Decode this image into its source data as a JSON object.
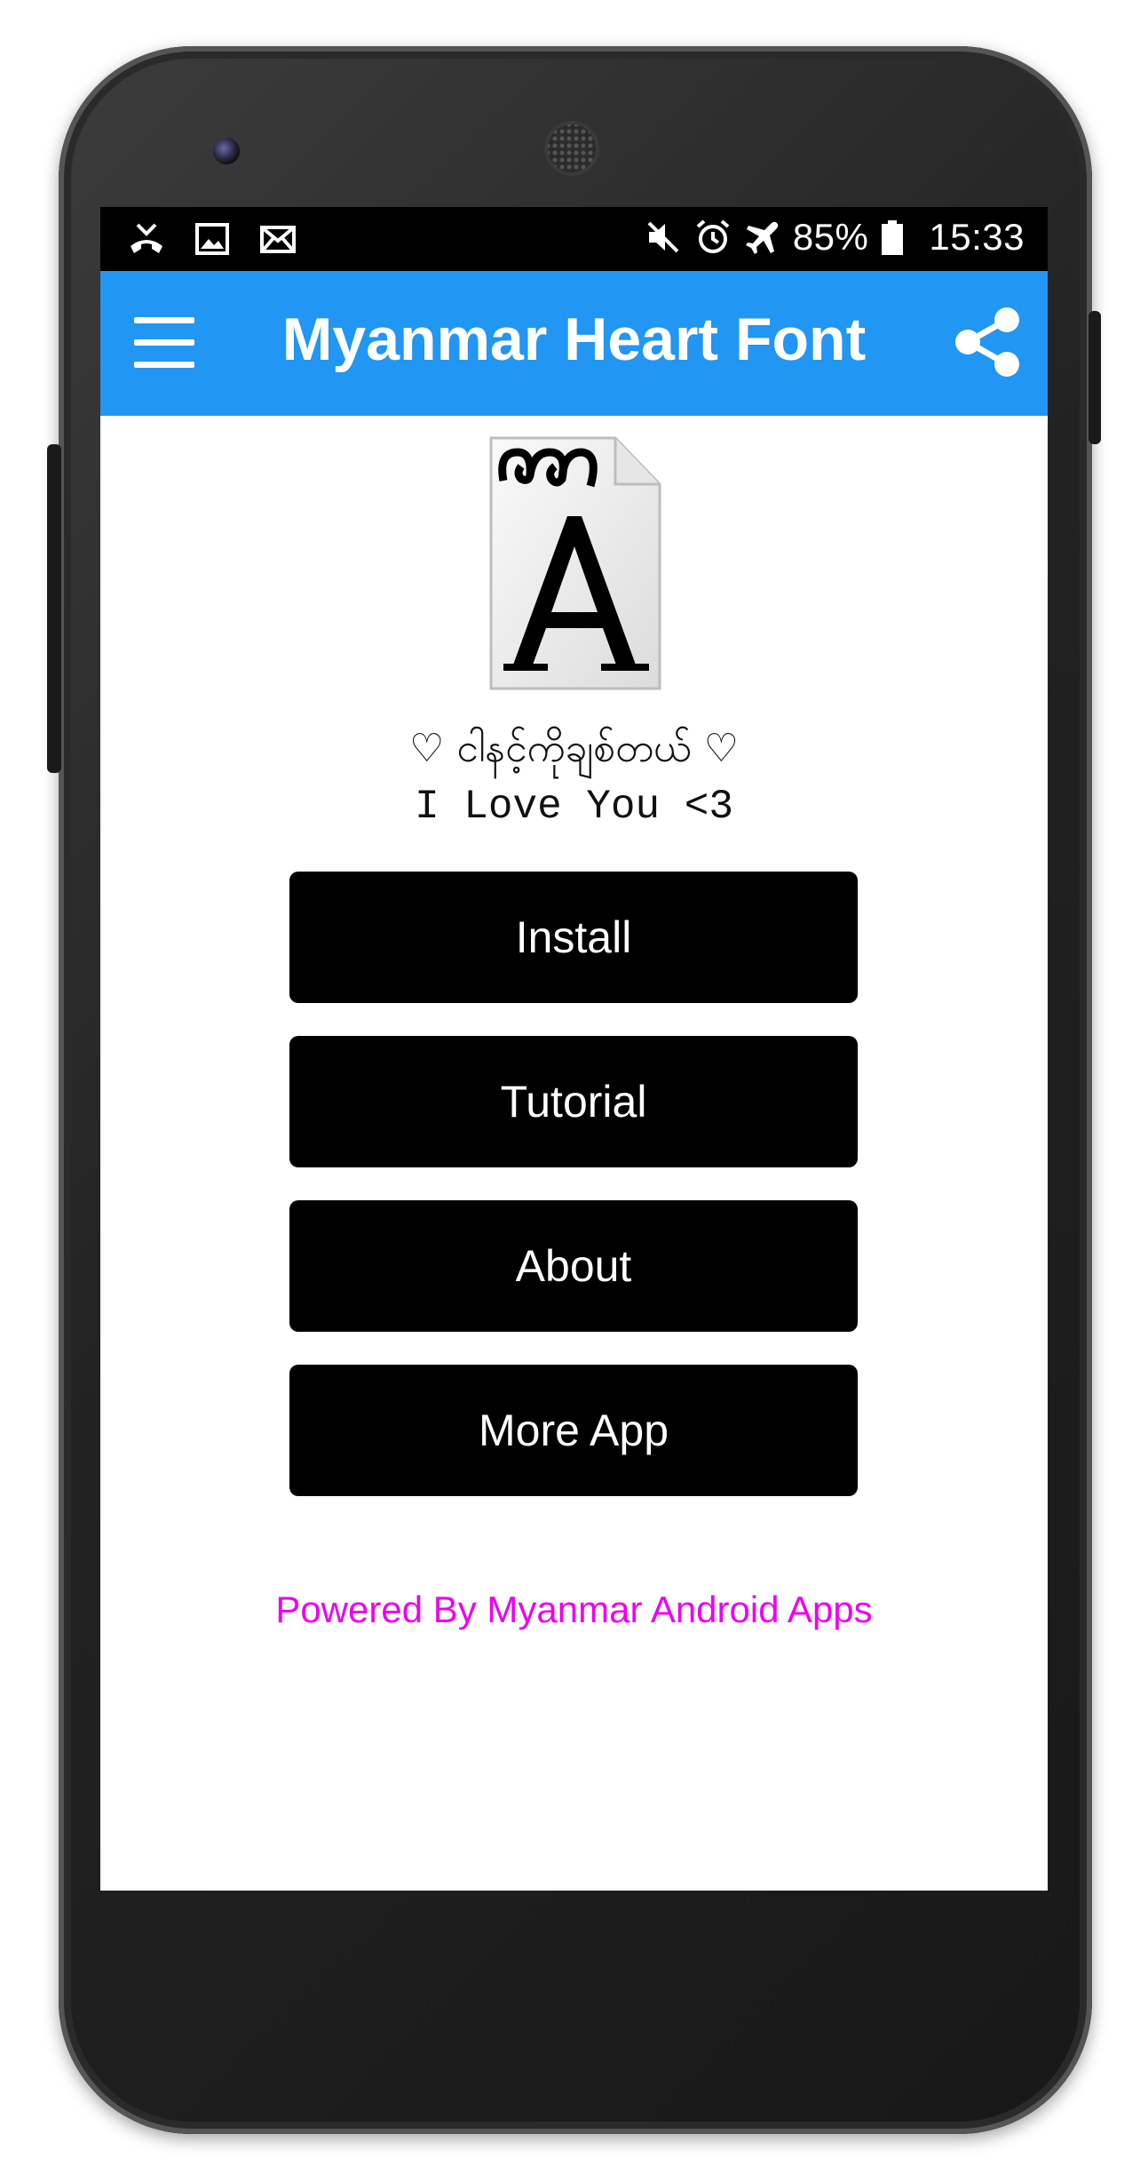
{
  "status_bar": {
    "battery": "85%",
    "time": "15:33",
    "left_icons": [
      "missed-call-icon",
      "image-icon",
      "email-icon"
    ],
    "right_icons": [
      "mute-icon",
      "alarm-icon",
      "airplane-icon",
      "battery-icon"
    ]
  },
  "app_bar": {
    "title": "Myanmar Heart Font",
    "color": "#2196f3",
    "left_icon": "menu-icon",
    "right_icon": "share-icon"
  },
  "content": {
    "tagline_myanmar": "♡ ငါနင့်ကိုချစ်တယ် ♡",
    "tagline_english": "I Love You <3",
    "buttons": [
      {
        "label": "Install"
      },
      {
        "label": "Tutorial"
      },
      {
        "label": "About"
      },
      {
        "label": "More App"
      }
    ],
    "footer": "Powered By Myanmar Android Apps",
    "footer_color": "#ee00ee"
  }
}
